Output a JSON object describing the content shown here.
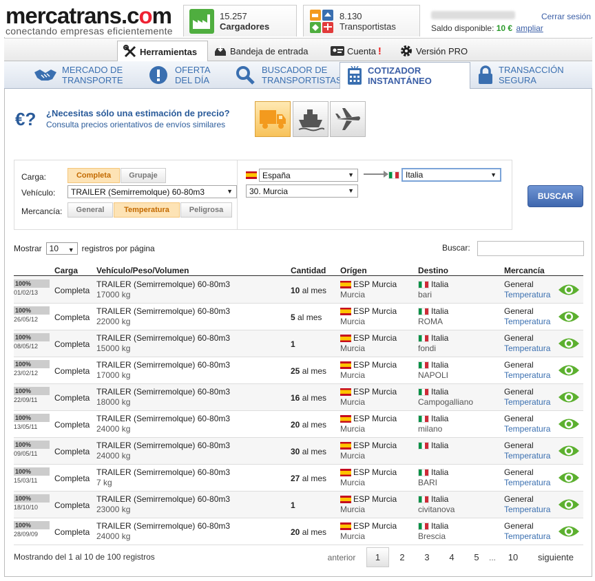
{
  "header": {
    "logo_main_a": "mercatrans.c",
    "logo_main_b": "m",
    "logo_tagline": "conectando empresas eficientemente",
    "cargadores_count": "15.257",
    "cargadores_label": "Cargadores",
    "transportistas_count": "8.130",
    "transportistas_label": "Transportistas",
    "logout_label": "Cerrar sesión",
    "saldo_label": "Saldo disponible:",
    "saldo_amount": "10 €",
    "ampliar_label": "ampliar"
  },
  "topnav": {
    "herramientas": "Herramientas",
    "bandeja": "Bandeja de entrada",
    "cuenta": "Cuenta",
    "cuenta_alert": "!",
    "pro": "Versión PRO"
  },
  "subnav": {
    "mercado_l1": "MERCADO DE",
    "mercado_l2": "TRANSPORTE",
    "oferta_l1": "OFERTA",
    "oferta_l2": "DEL DÍA",
    "buscador_l1": "BUSCADOR DE",
    "buscador_l2": "TRANSPORTISTAS",
    "cotizador_l1": "COTIZADOR",
    "cotizador_l2": "INSTANTÁNEO",
    "transaccion_l1": "TRANSACCIÓN",
    "transaccion_l2": "SEGURA"
  },
  "intro": {
    "euro": "€?",
    "title": "¿Necesitas sólo una estimación de precio?",
    "subtitle": "Consulta precios orientativos de envíos similares"
  },
  "filters": {
    "carga_label": "Carga:",
    "carga_options": [
      "Completa",
      "Grupaje"
    ],
    "vehiculo_label": "Vehículo:",
    "vehiculo_value": "TRAILER (Semirremolque) 60-80m3",
    "mercancia_label": "Mercancía:",
    "mercancia_options": [
      "General",
      "Temperatura",
      "Peligrosa"
    ],
    "origin_country": "España",
    "origin_region": "30. Murcia",
    "dest_country": "Italia",
    "search_button": "BUSCAR"
  },
  "table_controls": {
    "show_prefix": "Mostrar",
    "show_value": "10",
    "show_suffix": "registros por página",
    "search_label": "Buscar:"
  },
  "table": {
    "headers": [
      "Carga",
      "Vehículo/Peso/Volumen",
      "Cantidad",
      "Orígen",
      "Destino",
      "Mercancía"
    ],
    "rows": [
      {
        "pct": "100%",
        "date": "01/02/13",
        "carga": "Completa",
        "vehiculo": "TRAILER (Semirremolque) 60-80m3",
        "peso": "17000 kg",
        "cant_num": "10",
        "cant_unit": "al mes",
        "orig": "ESP Murcia",
        "orig_city": "Murcia",
        "dest": "Italia",
        "dest_city": "bari",
        "merc": "General",
        "merc2": "Temperatura"
      },
      {
        "pct": "100%",
        "date": "26/05/12",
        "carga": "Completa",
        "vehiculo": "TRAILER (Semirremolque) 60-80m3",
        "peso": "22000 kg",
        "cant_num": "5",
        "cant_unit": "al mes",
        "orig": "ESP Murcia",
        "orig_city": "Murcia",
        "dest": "Italia",
        "dest_city": "ROMA",
        "merc": "General",
        "merc2": "Temperatura"
      },
      {
        "pct": "100%",
        "date": "08/05/12",
        "carga": "Completa",
        "vehiculo": "TRAILER (Semirremolque) 60-80m3",
        "peso": "15000 kg",
        "cant_num": "1",
        "cant_unit": "",
        "orig": "ESP Murcia",
        "orig_city": "Murcia",
        "dest": "Italia",
        "dest_city": "fondi",
        "merc": "General",
        "merc2": "Temperatura"
      },
      {
        "pct": "100%",
        "date": "23/02/12",
        "carga": "Completa",
        "vehiculo": "TRAILER (Semirremolque) 60-80m3",
        "peso": "17000 kg",
        "cant_num": "25",
        "cant_unit": "al mes",
        "orig": "ESP Murcia",
        "orig_city": "Murcia",
        "dest": "Italia",
        "dest_city": "NAPOLI",
        "merc": "General",
        "merc2": "Temperatura"
      },
      {
        "pct": "100%",
        "date": "22/09/11",
        "carga": "Completa",
        "vehiculo": "TRAILER (Semirremolque) 60-80m3",
        "peso": "18000 kg",
        "cant_num": "16",
        "cant_unit": "al mes",
        "orig": "ESP Murcia",
        "orig_city": "Murcia",
        "dest": "Italia",
        "dest_city": "Campogalliano",
        "merc": "General",
        "merc2": "Temperatura"
      },
      {
        "pct": "100%",
        "date": "13/05/11",
        "carga": "Completa",
        "vehiculo": "TRAILER (Semirremolque) 60-80m3",
        "peso": "24000 kg",
        "cant_num": "20",
        "cant_unit": "al mes",
        "orig": "ESP Murcia",
        "orig_city": "Murcia",
        "dest": "Italia",
        "dest_city": "milano",
        "merc": "General",
        "merc2": "Temperatura"
      },
      {
        "pct": "100%",
        "date": "09/05/11",
        "carga": "Completa",
        "vehiculo": "TRAILER (Semirremolque) 60-80m3",
        "peso": "24000 kg",
        "cant_num": "30",
        "cant_unit": "al mes",
        "orig": "ESP Murcia",
        "orig_city": "Murcia",
        "dest": "Italia",
        "dest_city": "",
        "merc": "General",
        "merc2": "Temperatura"
      },
      {
        "pct": "100%",
        "date": "15/03/11",
        "carga": "Completa",
        "vehiculo": "TRAILER (Semirremolque) 60-80m3",
        "peso": "7 kg",
        "cant_num": "27",
        "cant_unit": "al mes",
        "orig": "ESP Murcia",
        "orig_city": "Murcia",
        "dest": "Italia",
        "dest_city": "BARI",
        "merc": "General",
        "merc2": "Temperatura"
      },
      {
        "pct": "100%",
        "date": "18/10/10",
        "carga": "Completa",
        "vehiculo": "TRAILER (Semirremolque) 60-80m3",
        "peso": "23000 kg",
        "cant_num": "1",
        "cant_unit": "",
        "orig": "ESP Murcia",
        "orig_city": "Murcia",
        "dest": "Italia",
        "dest_city": "civitanova",
        "merc": "General",
        "merc2": "Temperatura"
      },
      {
        "pct": "100%",
        "date": "28/09/09",
        "carga": "Completa",
        "vehiculo": "TRAILER (Semirremolque) 60-80m3",
        "peso": "24000 kg",
        "cant_num": "20",
        "cant_unit": "al mes",
        "orig": "ESP Murcia",
        "orig_city": "Murcia",
        "dest": "Italia",
        "dest_city": "Brescia",
        "merc": "General",
        "merc2": "Temperatura"
      }
    ]
  },
  "footer": {
    "info": "Mostrando del 1 al 10 de 100 registros",
    "prev": "anterior",
    "pages": [
      "1",
      "2",
      "3",
      "4",
      "5"
    ],
    "ellipsis": "...",
    "last": "10",
    "next": "siguiente"
  },
  "icons": {
    "cargadores": "factory-icon",
    "transportistas": "transport-modes-icon",
    "view": "eye-icon"
  },
  "colors": {
    "link_blue": "#3a6fb0",
    "accent_orange": "#c36a00",
    "saldo_green": "#2a9a2a",
    "alert_red": "#e22222",
    "button_blue": "#4a72b8"
  }
}
